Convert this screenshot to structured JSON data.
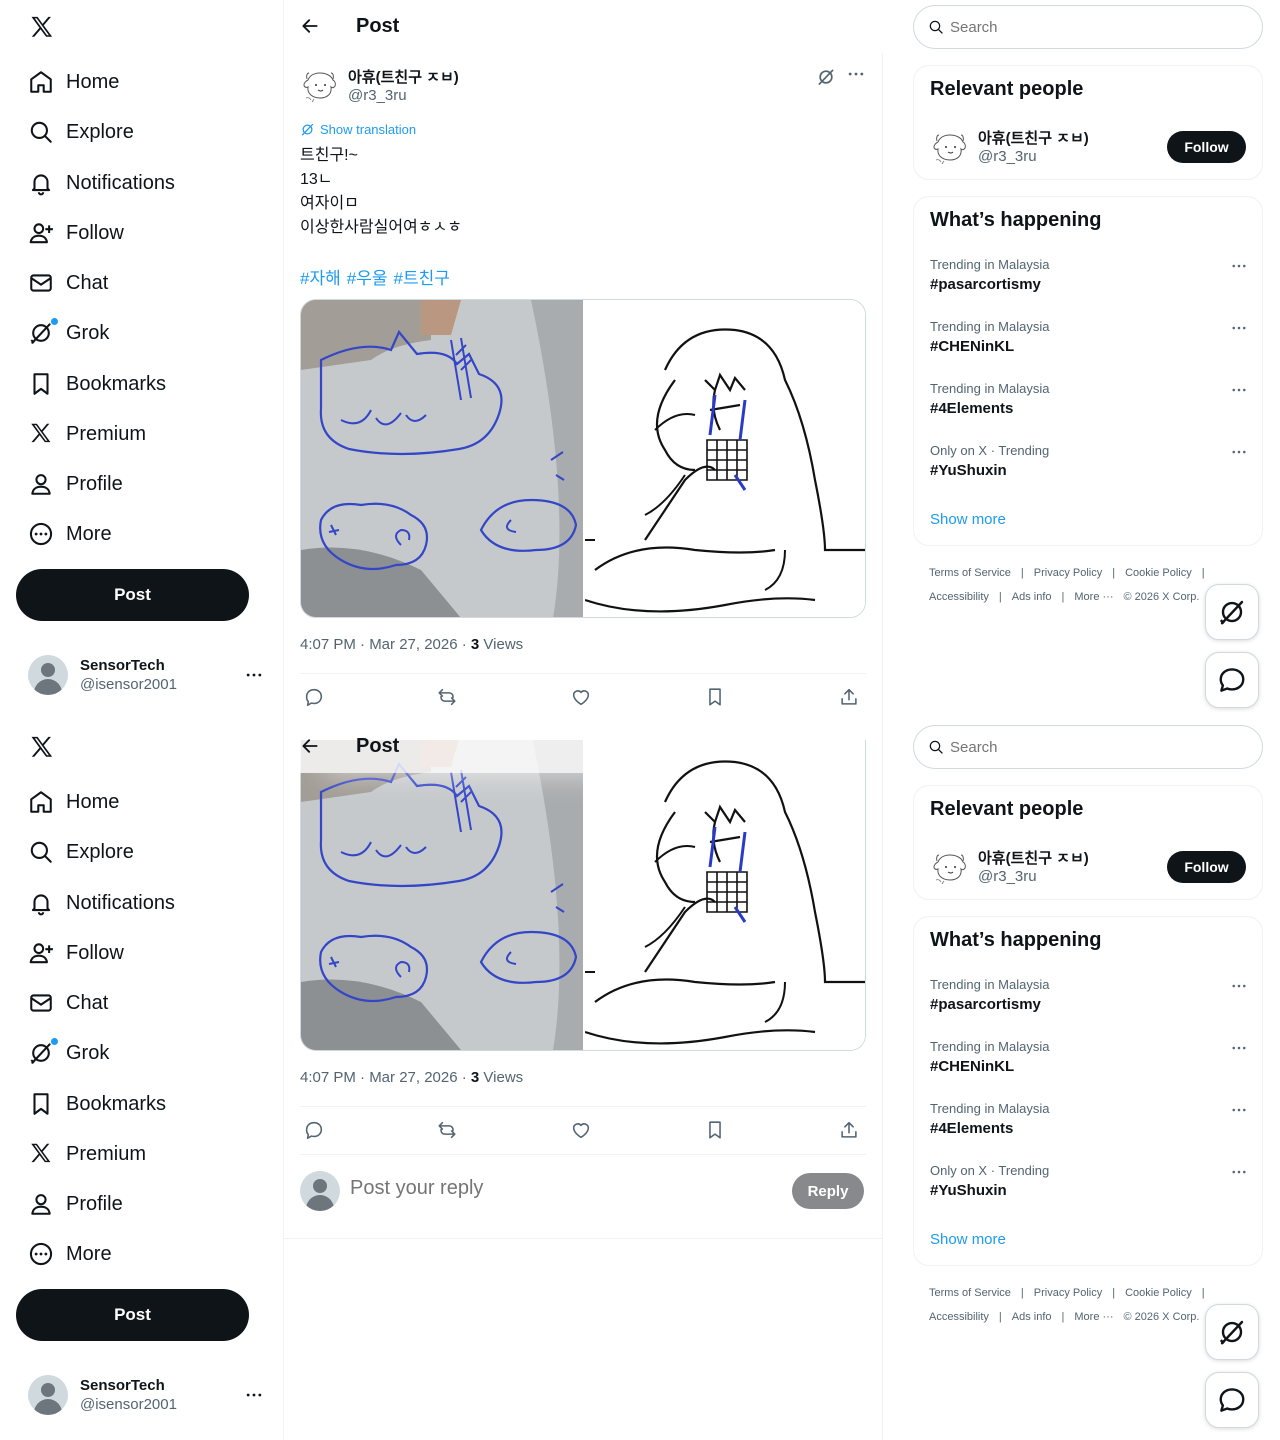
{
  "nav": {
    "items": [
      {
        "label": "Home",
        "icon": "home-icon"
      },
      {
        "label": "Explore",
        "icon": "search-icon"
      },
      {
        "label": "Notifications",
        "icon": "bell-icon"
      },
      {
        "label": "Follow",
        "icon": "person-add-icon"
      },
      {
        "label": "Chat",
        "icon": "mail-icon"
      },
      {
        "label": "Grok",
        "icon": "grok-icon"
      },
      {
        "label": "Bookmarks",
        "icon": "bookmark-icon"
      },
      {
        "label": "Premium",
        "icon": "x-logo-icon"
      },
      {
        "label": "Profile",
        "icon": "person-icon"
      },
      {
        "label": "More",
        "icon": "more-circle-icon"
      }
    ],
    "post_label": "Post"
  },
  "account": {
    "name": "SensorTech",
    "handle": "@isensor2001"
  },
  "header": {
    "title": "Post"
  },
  "post": {
    "author_name": "아휴(트친구 ㅈㅂ)",
    "author_handle": "@r3_3ru",
    "show_translation": "Show translation",
    "lines": [
      "트친구!~",
      "13ㄴ",
      "여자이ㅁ",
      "이상한사람실어여ㅎㅅㅎ"
    ],
    "hashtags": [
      "#자해",
      "#우울",
      "#트친구"
    ],
    "time": "4:07 PM · Mar 27, 2026 · ",
    "views_count": "3",
    "views_label": " Views"
  },
  "reply": {
    "placeholder": "Post your reply",
    "button": "Reply"
  },
  "search": {
    "placeholder": "Search"
  },
  "relevant_people": {
    "title": "Relevant people",
    "name": "아휴(트친구 ㅈㅂ)",
    "handle": "@r3_3ru",
    "follow": "Follow"
  },
  "happening": {
    "title": "What’s happening",
    "trends": [
      {
        "context": "Trending in Malaysia",
        "name": "#pasarcortismy"
      },
      {
        "context": "Trending in Malaysia",
        "name": "#CHENinKL"
      },
      {
        "context": "Trending in Malaysia",
        "name": "#4Elements"
      },
      {
        "context": "Only on X · Trending",
        "name": "#YuShuxin"
      }
    ],
    "show_more": "Show more"
  },
  "footer": {
    "links": [
      "Terms of Service",
      "Privacy Policy",
      "Cookie Policy",
      "Accessibility",
      "Ads info",
      "More ···",
      "© 2026 X Corp."
    ]
  },
  "colors": {
    "accent": "#1d9bf0",
    "text": "#0f1419",
    "muted": "#536471",
    "border": "#eff3f4"
  }
}
